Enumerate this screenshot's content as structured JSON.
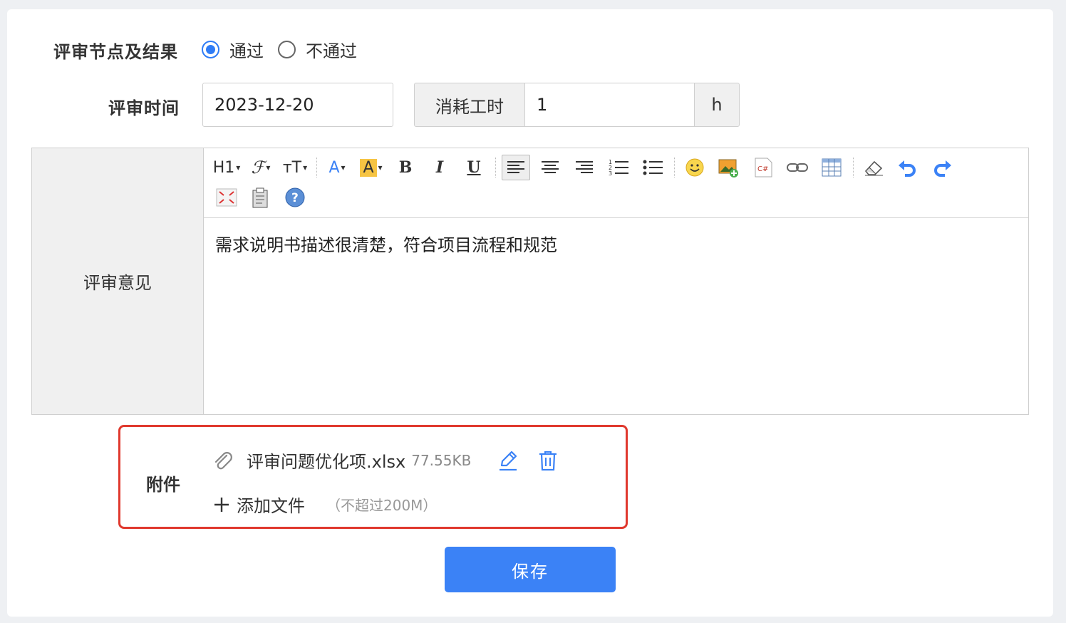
{
  "review": {
    "node_label": "评审节点及结果",
    "options": [
      "通过",
      "不通过"
    ],
    "selected": "通过",
    "time_label": "评审时间",
    "date_value": "2023-12-20",
    "hours_label": "消耗工时",
    "hours_value": "1",
    "hours_unit": "h"
  },
  "editor": {
    "label": "评审意见",
    "content": "需求说明书描述很清楚，符合项目流程和规范",
    "toolbar": {
      "heading": "H1",
      "fontsize": "тT",
      "bold": "B",
      "italic": "I",
      "underline": "U",
      "font_color": "A",
      "bg_color": "A",
      "code": "C#"
    }
  },
  "attachment": {
    "label": "附件",
    "file_name": "评审问题优化项.xlsx",
    "file_size": "77.55KB",
    "add_label": "添加文件",
    "add_hint": "（不超过200M）"
  },
  "actions": {
    "save_label": "保存"
  },
  "colors": {
    "primary": "#3b82f6",
    "highlight_border": "#e0392e"
  }
}
